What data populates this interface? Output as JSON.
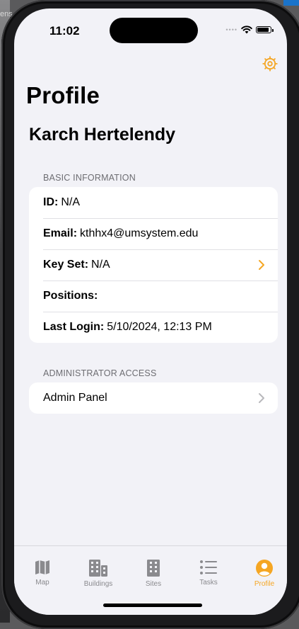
{
  "desktop": {
    "text": "ens"
  },
  "status_bar": {
    "time": "11:02"
  },
  "page": {
    "title": "Profile",
    "user_name": "Karch Hertelendy"
  },
  "basic_info": {
    "header": "BASIC INFORMATION",
    "id_label": "ID:",
    "id_value": "N/A",
    "email_label": "Email:",
    "email_value": "kthhx4@umsystem.edu",
    "keyset_label": "Key Set:",
    "keyset_value": "N/A",
    "positions_label": "Positions:",
    "positions_value": "",
    "lastlogin_label": "Last Login:",
    "lastlogin_value": "5/10/2024, 12:13 PM"
  },
  "admin": {
    "header": "ADMINISTRATOR ACCESS",
    "panel_label": "Admin Panel"
  },
  "tabs": [
    {
      "label": "Map",
      "icon": "map-icon"
    },
    {
      "label": "Buildings",
      "icon": "buildings-icon"
    },
    {
      "label": "Sites",
      "icon": "sites-icon"
    },
    {
      "label": "Tasks",
      "icon": "tasks-icon"
    },
    {
      "label": "Profile",
      "icon": "profile-icon",
      "active": true
    }
  ],
  "colors": {
    "accent": "#f5a623",
    "background": "#f2f2f7",
    "inactive": "#8a8a8e"
  }
}
